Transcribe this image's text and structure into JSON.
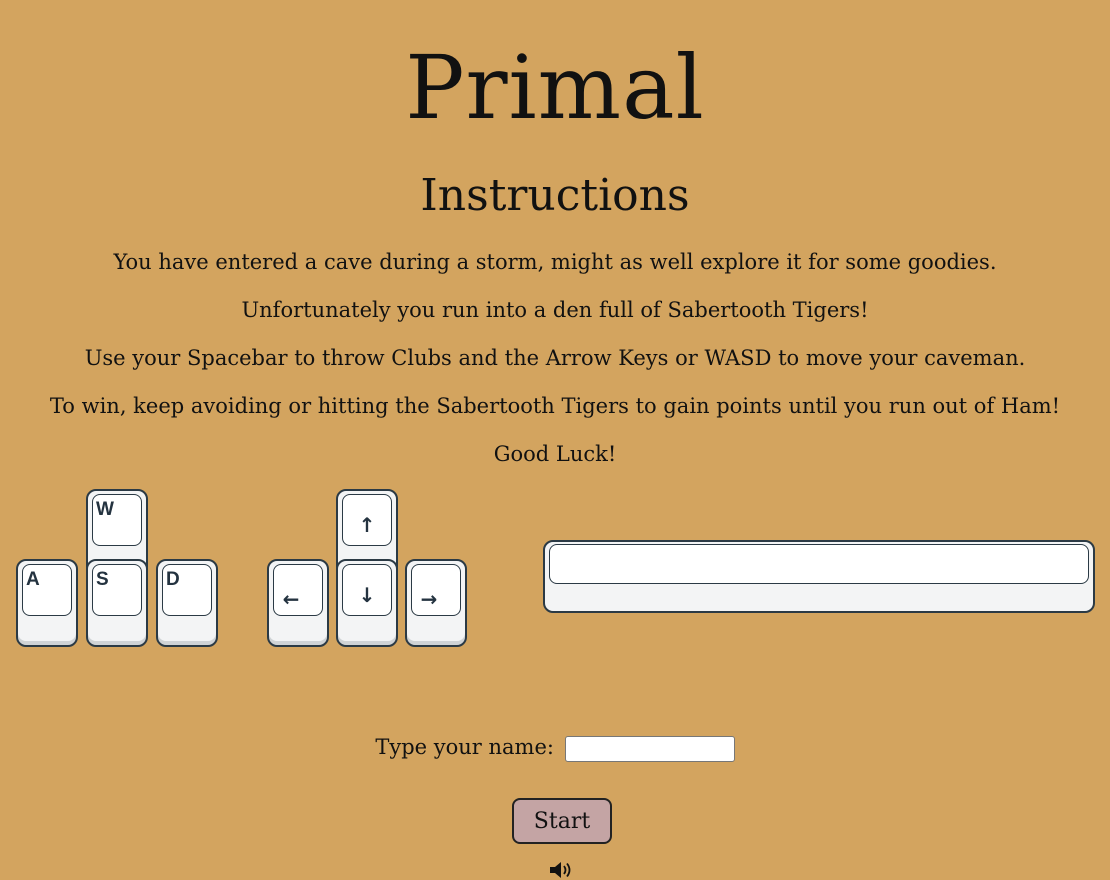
{
  "game": {
    "title": "Primal",
    "subtitle": "Instructions",
    "instructions": [
      "You have entered a cave during a storm, might as well explore it for some goodies.",
      "Unfortunately you run into a den full of Sabertooth Tigers!",
      "Use your Spacebar to throw Clubs and the Arrow Keys or WASD to move your caveman.",
      "To win, keep avoiding or hitting the Sabertooth Tigers to gain points until you run out of Ham!",
      "Good Luck!"
    ]
  },
  "keys": {
    "wasd": {
      "w": "W",
      "a": "A",
      "s": "S",
      "d": "D"
    },
    "arrows": {
      "up": "↑",
      "left": "←",
      "down": "↓",
      "right": "→"
    }
  },
  "form": {
    "name_label": "Type your name:",
    "name_value": "",
    "start_label": "Start"
  },
  "icons": {
    "sound": "speaker-icon"
  },
  "colors": {
    "background": "#d3a45f",
    "start_button": "#c4a4a4",
    "key_outline": "#2b3a45"
  }
}
